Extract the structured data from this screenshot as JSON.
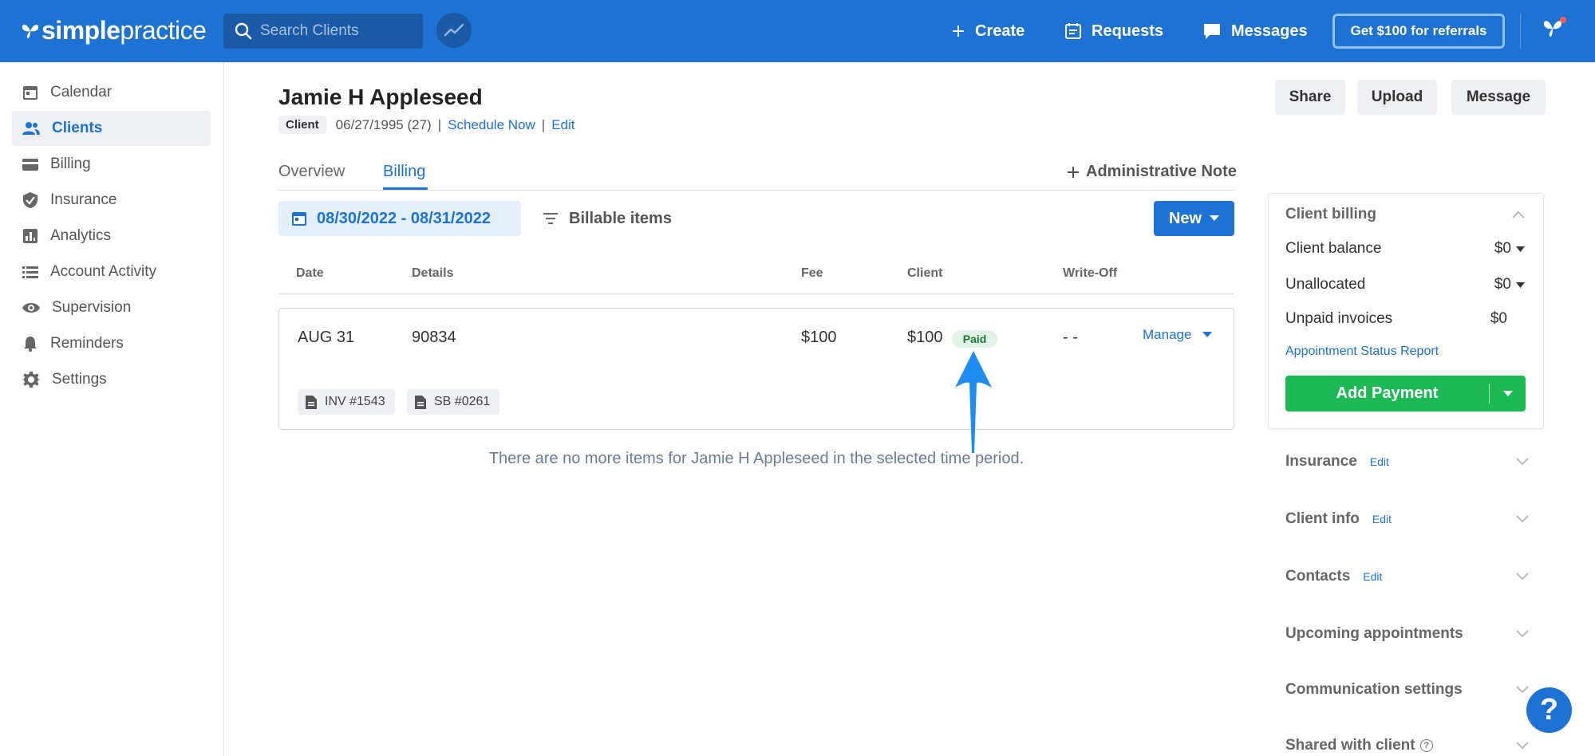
{
  "topbar": {
    "logo_bold": "simple",
    "logo_light": "practice",
    "search_placeholder": "Search Clients",
    "create_label": "Create",
    "requests_label": "Requests",
    "messages_label": "Messages",
    "referral_label": "Get $100 for referrals"
  },
  "sidebar": {
    "items": [
      {
        "label": "Calendar",
        "icon": "calendar-icon"
      },
      {
        "label": "Clients",
        "icon": "people-icon",
        "active": true
      },
      {
        "label": "Billing",
        "icon": "card-icon"
      },
      {
        "label": "Insurance",
        "icon": "shield-icon"
      },
      {
        "label": "Analytics",
        "icon": "bar-chart-icon"
      },
      {
        "label": "Account Activity",
        "icon": "list-icon"
      },
      {
        "label": "Supervision",
        "icon": "eye-icon"
      },
      {
        "label": "Reminders",
        "icon": "bell-icon"
      },
      {
        "label": "Settings",
        "icon": "gear-icon"
      }
    ]
  },
  "client": {
    "name": "Jamie H Appleseed",
    "badge": "Client",
    "dob": "06/27/1995 (27)",
    "separator": "|",
    "schedule_link": "Schedule Now",
    "edit_link": "Edit"
  },
  "header_buttons": {
    "share": "Share",
    "upload": "Upload",
    "message": "Message"
  },
  "tabs": {
    "overview": "Overview",
    "billing": "Billing",
    "admin_note": "Administrative Note"
  },
  "filters": {
    "date_range": "08/30/2022 - 08/31/2022",
    "billable": "Billable items",
    "new_label": "New"
  },
  "table": {
    "columns": {
      "date": "Date",
      "details": "Details",
      "fee": "Fee",
      "client": "Client",
      "writeoff": "Write-Off"
    },
    "row": {
      "date": "AUG 31",
      "details": "90834",
      "fee": "$100",
      "client": "$100",
      "status": "Paid",
      "writeoff": "- -",
      "manage": "Manage",
      "invoice": "INV #1543",
      "statement": "SB #0261"
    },
    "empty_message": "There are no more items for Jamie H Appleseed in the selected time period."
  },
  "client_billing": {
    "title": "Client billing",
    "balance_label": "Client balance",
    "balance_value": "$0",
    "unallocated_label": "Unallocated",
    "unallocated_value": "$0",
    "unpaid_label": "Unpaid invoices",
    "unpaid_value": "$0",
    "report_link": "Appointment Status Report",
    "add_payment": "Add Payment"
  },
  "sections": {
    "insurance": "Insurance",
    "client_info": "Client info",
    "contacts": "Contacts",
    "upcoming": "Upcoming appointments",
    "communication": "Communication settings",
    "shared": "Shared with client",
    "edit": "Edit"
  },
  "help": {
    "label": "?"
  },
  "colors": {
    "brand": "#1d72d4",
    "success": "#1db954",
    "annotation_arrow": "#1e8cf0"
  }
}
